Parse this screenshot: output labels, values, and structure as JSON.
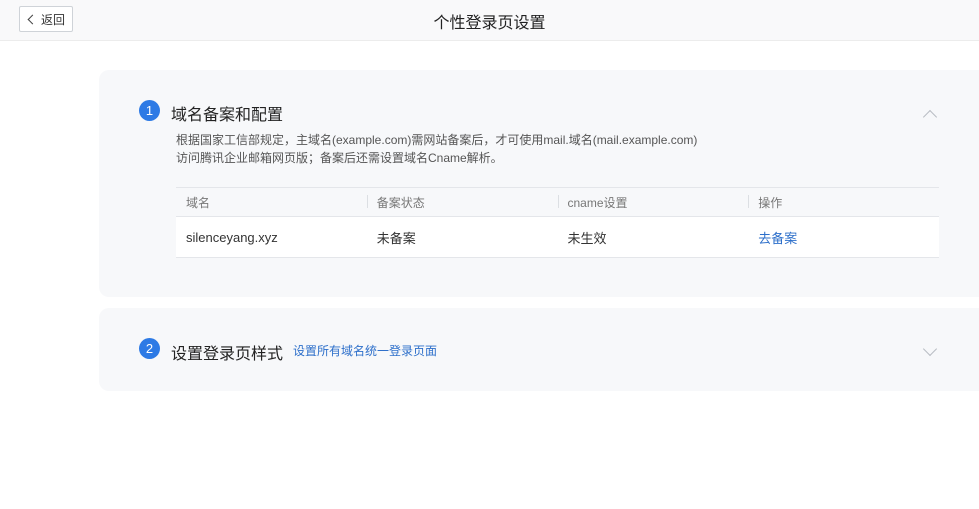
{
  "header": {
    "back_label": "返回",
    "title": "个性登录页设置"
  },
  "steps": [
    {
      "number": "1",
      "title": "域名备案和配置",
      "description_lines": [
        "根据国家工信部规定，主域名(example.com)需网站备案后，才可使用mail.域名(mail.example.com)",
        "访问腾讯企业邮箱网页版；备案后还需设置域名Cname解析。"
      ],
      "table": {
        "columns": [
          "域名",
          "备案状态",
          "cname设置",
          "操作"
        ],
        "rows": [
          {
            "domain": "silenceyang.xyz",
            "filing_status": "未备案",
            "cname": "未生效",
            "action": "去备案"
          }
        ]
      },
      "expanded": true
    },
    {
      "number": "2",
      "title": "设置登录页样式",
      "link": "设置所有域名统一登录页面",
      "expanded": false
    }
  ],
  "colors": {
    "accent": "#2d7ae5",
    "link": "#2d6fca",
    "panel_bg": "#f7f8fa"
  }
}
